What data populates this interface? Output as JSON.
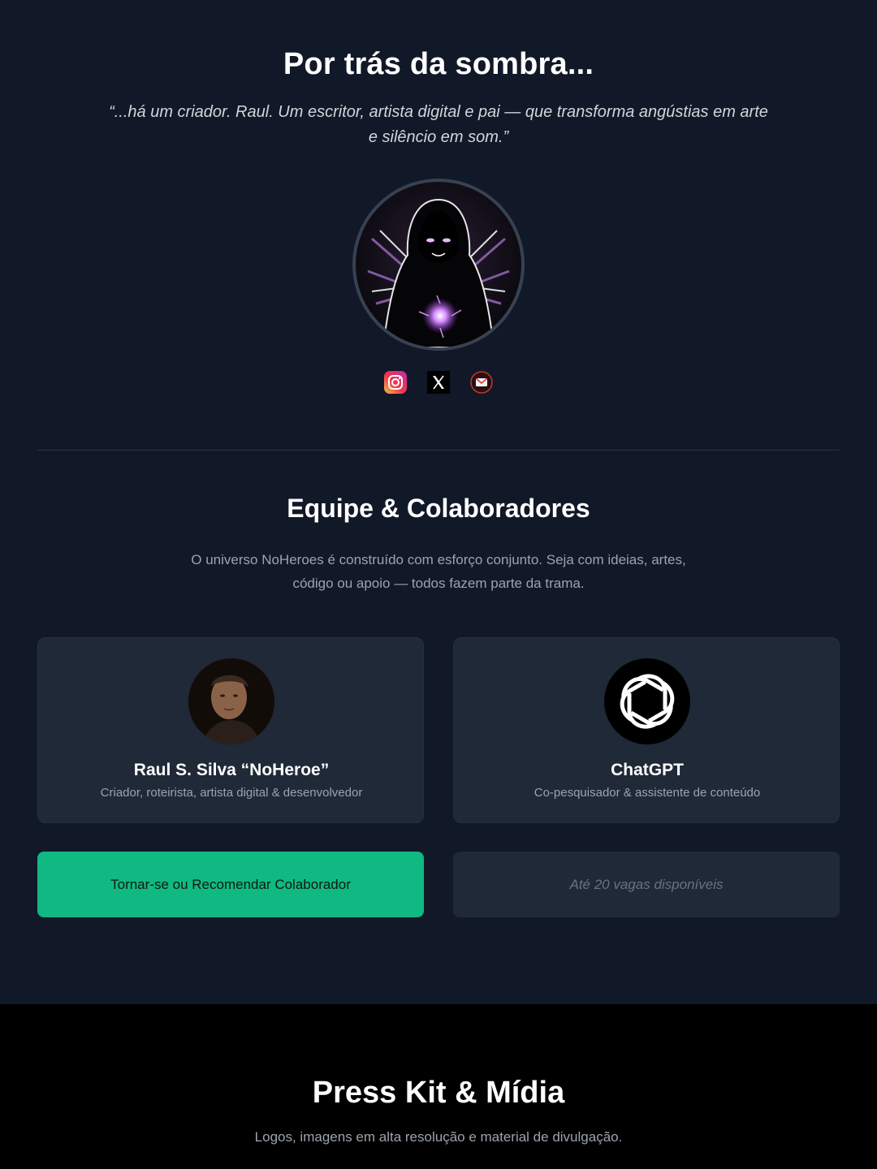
{
  "about": {
    "title": "Por trás da sombra...",
    "quote": "“...há um criador. Raul. Um escritor, artista digital e pai — que transforma angústias em arte e silêncio em som.”"
  },
  "socials": [
    {
      "icon": "instagram-icon"
    },
    {
      "icon": "x-twitter-icon"
    },
    {
      "icon": "email-icon"
    }
  ],
  "team": {
    "title": "Equipe & Colaboradores",
    "description": "O universo NoHeroes é construído com esforço conjunto. Seja com ideias, artes, código ou apoio — todos fazem parte da trama.",
    "members": [
      {
        "name": "Raul S. Silva “NoHeroe”",
        "role": "Criador, roteirista, artista digital & desenvolvedor"
      },
      {
        "name": "ChatGPT",
        "role": "Co-pesquisador & assistente de conteúdo"
      }
    ],
    "cta_label": "Tornar-se ou Recomendar Colaborador",
    "slots_text": "Até 20 vagas disponíveis"
  },
  "press": {
    "title": "Press Kit & Mídia",
    "description": "Logos, imagens em alta resolução e material de divulgação."
  },
  "colors": {
    "background": "#111827",
    "card": "#1f2937",
    "accent": "#10b981",
    "press_background": "#000000"
  }
}
